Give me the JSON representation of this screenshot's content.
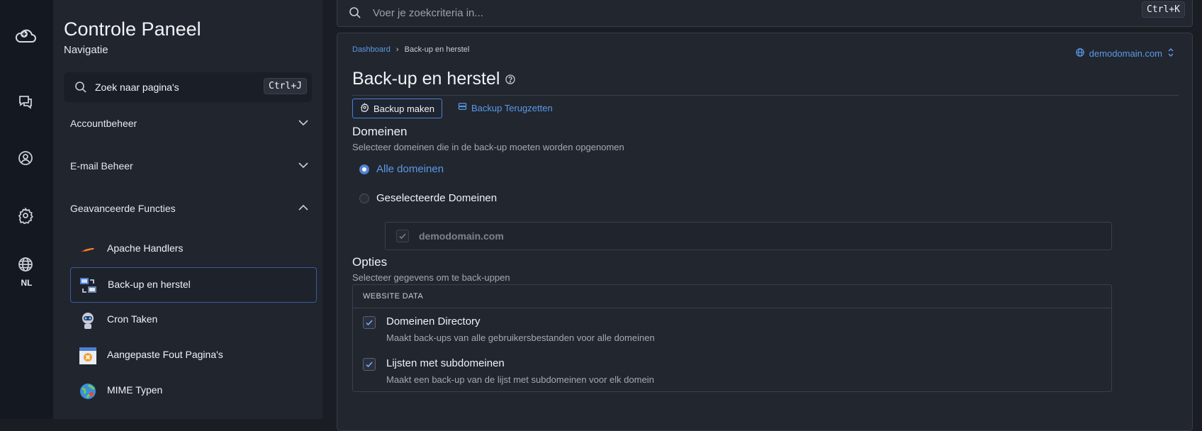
{
  "rail": {
    "language": "NL"
  },
  "sidebar": {
    "title": "Controle Paneel",
    "subtitle": "Navigatie",
    "search": {
      "placeholder": "Zoek naar pagina's",
      "shortcut": "Ctrl+J"
    },
    "groups": [
      {
        "label": "Accountbeheer",
        "expanded": false
      },
      {
        "label": "E-mail Beheer",
        "expanded": false
      },
      {
        "label": "Geavanceerde Functies",
        "expanded": true
      }
    ],
    "items": [
      {
        "label": "Apache Handlers",
        "icon": "feather-icon"
      },
      {
        "label": "Back-up en herstel",
        "icon": "backup-icon",
        "active": true
      },
      {
        "label": "Cron Taken",
        "icon": "robot-icon"
      },
      {
        "label": "Aangepaste Fout Pagina's",
        "icon": "error-page-icon"
      },
      {
        "label": "MIME Typen",
        "icon": "mime-icon"
      }
    ]
  },
  "topbar": {
    "search_placeholder": "Voer je zoekcriteria in...",
    "shortcut": "Ctrl+K"
  },
  "main": {
    "breadcrumb": {
      "root": "Dashboard",
      "separator": "›",
      "current": "Back-up en herstel"
    },
    "domain_selector": "demodomain.com",
    "title": "Back-up en herstel",
    "tabs": [
      {
        "label": "Backup maken",
        "active": true
      },
      {
        "label": "Backup Terugzetten",
        "active": false
      }
    ],
    "domains_section": {
      "heading": "Domeinen",
      "description": "Selecteer domeinen die in de back-up moeten worden opgenomen",
      "options": [
        {
          "label": "Alle domeinen",
          "selected": true
        },
        {
          "label": "Geselecteerde Domeinen",
          "selected": false
        }
      ],
      "domain_list": [
        {
          "name": "demodomain.com",
          "checked": true,
          "disabled": true
        }
      ]
    },
    "options_section": {
      "heading": "Opties",
      "description": "Selecteer gegevens om te back-uppen",
      "table_header": "WEBSITE DATA",
      "rows": [
        {
          "label": "Domeinen Directory",
          "description": "Maakt back-ups van alle gebruikersbestanden voor alle domeinen",
          "checked": true
        },
        {
          "label": "Lijsten met subdomeinen",
          "description": "Maakt een back-up van de lijst met subdomeinen voor elk domein",
          "checked": true
        }
      ]
    }
  },
  "colors": {
    "accent": "#4d7fd0",
    "link": "#5a9ae8",
    "bg": "#1a1d24",
    "sidebar": "#21252e",
    "rail": "#141820"
  }
}
